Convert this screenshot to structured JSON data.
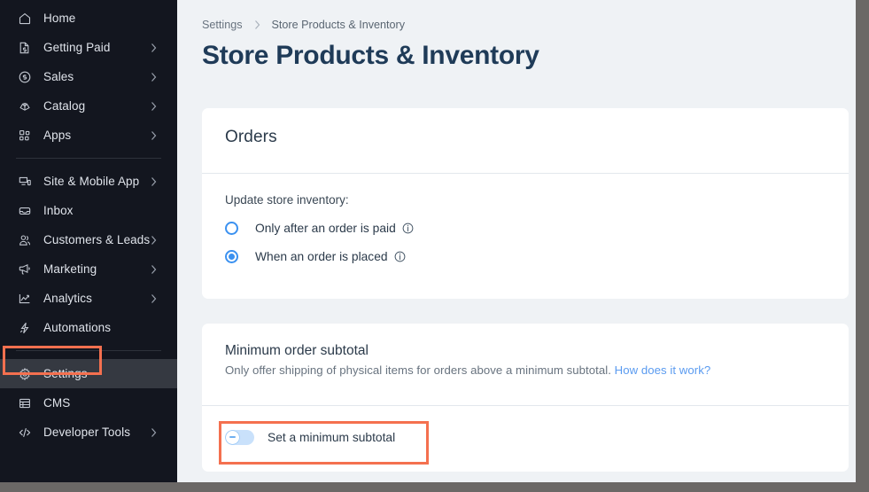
{
  "sidebar": {
    "groups": [
      {
        "items": [
          {
            "label": "Home",
            "icon": "home-icon",
            "chevron": false,
            "active": false
          },
          {
            "label": "Getting Paid",
            "icon": "invoice-icon",
            "chevron": true,
            "active": false
          },
          {
            "label": "Sales",
            "icon": "dollar-icon",
            "chevron": true,
            "active": false
          },
          {
            "label": "Catalog",
            "icon": "catalog-icon",
            "chevron": true,
            "active": false
          },
          {
            "label": "Apps",
            "icon": "apps-icon",
            "chevron": true,
            "active": false
          }
        ]
      },
      {
        "items": [
          {
            "label": "Site & Mobile App",
            "icon": "devices-icon",
            "chevron": true,
            "active": false
          },
          {
            "label": "Inbox",
            "icon": "inbox-icon",
            "chevron": false,
            "active": false
          },
          {
            "label": "Customers & Leads",
            "icon": "customers-icon",
            "chevron": true,
            "active": false
          },
          {
            "label": "Marketing",
            "icon": "megaphone-icon",
            "chevron": true,
            "active": false
          },
          {
            "label": "Analytics",
            "icon": "chart-line-icon",
            "chevron": true,
            "active": false
          },
          {
            "label": "Automations",
            "icon": "bolt-icon",
            "chevron": false,
            "active": false
          }
        ]
      },
      {
        "items": [
          {
            "label": "Settings",
            "icon": "gear-icon",
            "chevron": false,
            "active": true
          },
          {
            "label": "CMS",
            "icon": "database-icon",
            "chevron": false,
            "active": false
          },
          {
            "label": "Developer Tools",
            "icon": "code-icon",
            "chevron": true,
            "active": false
          }
        ]
      }
    ]
  },
  "breadcrumb": {
    "parent": "Settings",
    "separator": "chevron-right-icon",
    "current": "Store Products & Inventory"
  },
  "page": {
    "title": "Store Products & Inventory"
  },
  "orders_card": {
    "title": "Orders",
    "field_label": "Update store inventory:",
    "options": [
      {
        "label": "Only after an order is paid",
        "checked": false,
        "info": "info-icon"
      },
      {
        "label": "When an order is placed",
        "checked": true,
        "info": "info-icon"
      }
    ]
  },
  "subtotal_card": {
    "title": "Minimum order subtotal",
    "description": "Only offer shipping of physical items for orders above a minimum subtotal.",
    "link_label": "How does it work?",
    "toggle": {
      "label": "Set a minimum subtotal",
      "state": "off"
    }
  },
  "colors": {
    "sidebar_bg": "#13161f",
    "sidebar_active_bg": "#353941",
    "page_bg": "#eff2f5",
    "card_bg": "#ffffff",
    "title_color": "#1f3b58",
    "accent_blue": "#3b91f0",
    "link_blue": "#5a9bf0",
    "annotation_red": "#f4704f",
    "toggle_track_off": "#c9e1fb",
    "scrollbar": "#6b6866"
  }
}
